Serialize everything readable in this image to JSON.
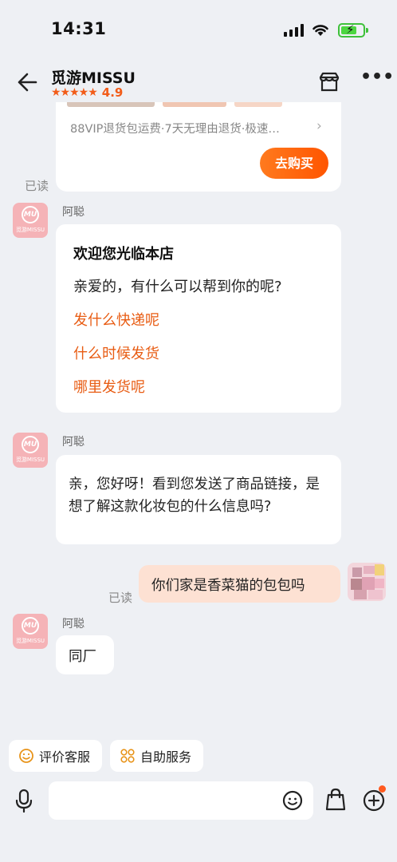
{
  "status_bar": {
    "time": "14:31"
  },
  "header": {
    "shop_name": "觅游MISSU",
    "stars": "★★★★★",
    "rating": "4.9"
  },
  "product_card": {
    "services": "88VIP退货包运费·7天无理由退货·极速…",
    "buy_label": "去购买"
  },
  "read_label": "已读",
  "avatar_brand": "觅游MISSU",
  "avatar_mark": "MU",
  "messages": [
    {
      "sender": "阿聪",
      "title": "欢迎您光临本店",
      "text": "亲爱的，有什么可以帮到你的呢?",
      "quick_questions": [
        "发什么快递呢",
        "什么时候发货",
        "哪里发货呢"
      ]
    },
    {
      "sender": "阿聪",
      "text": "亲，您好呀！看到您发送了商品链接，是想了解这款化妆包的什么信息吗?"
    },
    {
      "from": "me",
      "text": "你们家是香菜猫的包包吗"
    },
    {
      "sender": "阿聪",
      "text": "同厂"
    }
  ],
  "actions": [
    {
      "label": "评价客服",
      "icon": "smile-icon"
    },
    {
      "label": "自助服务",
      "icon": "grid-icon"
    }
  ],
  "input": {
    "placeholder": ""
  },
  "colors": {
    "accent": "#f25c19",
    "link": "#e85c13",
    "my_bubble": "#fde1d3",
    "background": "#eef0f4"
  }
}
